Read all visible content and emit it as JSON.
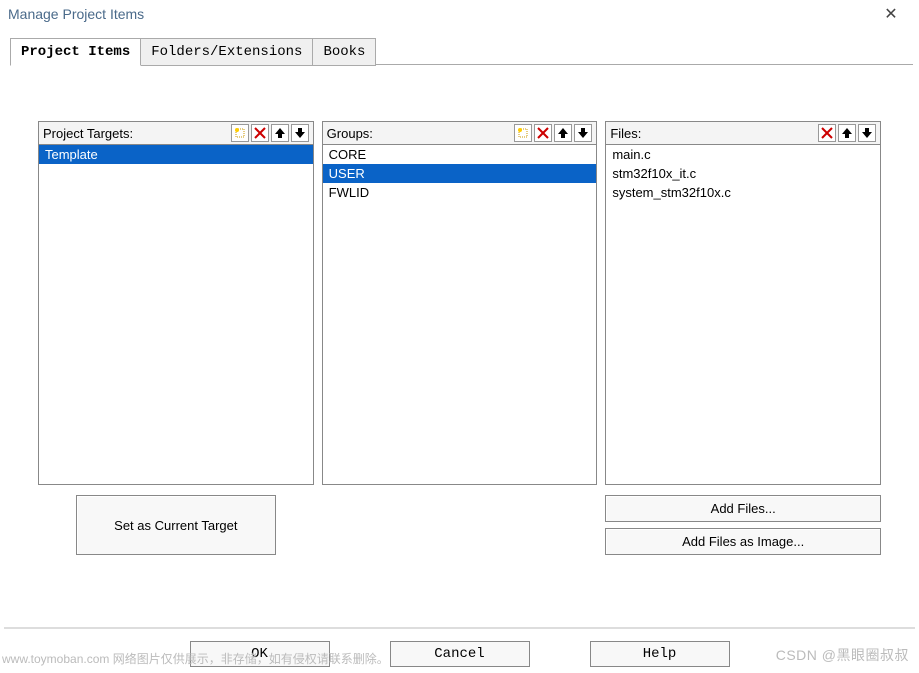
{
  "window": {
    "title": "Manage Project Items",
    "close_label": "✕"
  },
  "tabs": [
    {
      "label": "Project Items",
      "active": true
    },
    {
      "label": "Folders/Extensions",
      "active": false
    },
    {
      "label": "Books",
      "active": false
    }
  ],
  "columns": {
    "targets": {
      "header": "Project Targets:",
      "items": [
        {
          "label": "Template",
          "selected": true
        }
      ]
    },
    "groups": {
      "header": "Groups:",
      "items": [
        {
          "label": "CORE",
          "selected": false
        },
        {
          "label": "USER",
          "selected": true
        },
        {
          "label": "FWLID",
          "selected": false
        }
      ]
    },
    "files": {
      "header": "Files:",
      "items": [
        {
          "label": "main.c",
          "selected": false
        },
        {
          "label": "stm32f10x_it.c",
          "selected": false
        },
        {
          "label": "system_stm32f10x.c",
          "selected": false
        }
      ]
    }
  },
  "buttons": {
    "set_current_target": "Set as Current Target",
    "add_files": "Add Files...",
    "add_files_image": "Add Files as Image...",
    "ok": "OK",
    "cancel": "Cancel",
    "help": "Help"
  },
  "icons": {
    "new": "new-icon",
    "delete": "✕",
    "up": "↑",
    "down": "↓"
  },
  "watermarks": {
    "left": "www.toymoban.com 网络图片仅供展示，非存储，如有侵权请联系删除。",
    "right": "CSDN @黑眼圈叔叔"
  }
}
